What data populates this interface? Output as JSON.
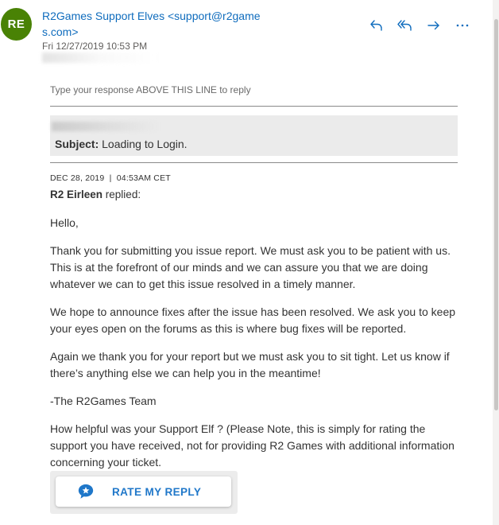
{
  "header": {
    "avatar_initials": "RE",
    "avatar_color": "#498205",
    "sender": "R2Games Support Elves <support@r2games.com>",
    "date": "Fri 12/27/2019 10:53 PM",
    "accent_color": "#0f6cbd",
    "actions": [
      {
        "name": "reply",
        "icon": "reply-icon"
      },
      {
        "name": "reply-all",
        "icon": "reply-all-icon"
      },
      {
        "name": "forward",
        "icon": "forward-icon"
      },
      {
        "name": "more",
        "icon": "more-icon"
      }
    ]
  },
  "email": {
    "reply_instruction": "Type your response ABOVE THIS LINE to reply",
    "subject_label": "Subject:",
    "subject_value": "Loading to Login.",
    "reply_meta": "DEC 28, 2019  |  04:53AM CET",
    "agent_name": "R2 Eirleen",
    "replied_text": "replied:",
    "paragraphs": [
      "Hello,",
      "Thank you for submitting you issue report. We must ask you to be patient with us. This is at the forefront of our minds and we can assure you that we are doing whatever we can to get this issue resolved in a timely manner.",
      "We hope to announce fixes after the issue has been resolved. We ask you to keep your eyes open on the forums as this is where bug fixes will be reported.",
      "Again we thank you for your report but we must ask you to sit tight. Let us know if there’s anything else we can help you in the meantime!",
      "-The R2Games Team",
      "How helpful was your Support Elf ? (Please Note, this is simply for rating the support you have received, not for providing R2 Games with additional information concerning your ticket."
    ],
    "rate_button": {
      "label": "RATE MY REPLY",
      "icon": "star-chat-icon",
      "color": "#1f77c9"
    }
  }
}
